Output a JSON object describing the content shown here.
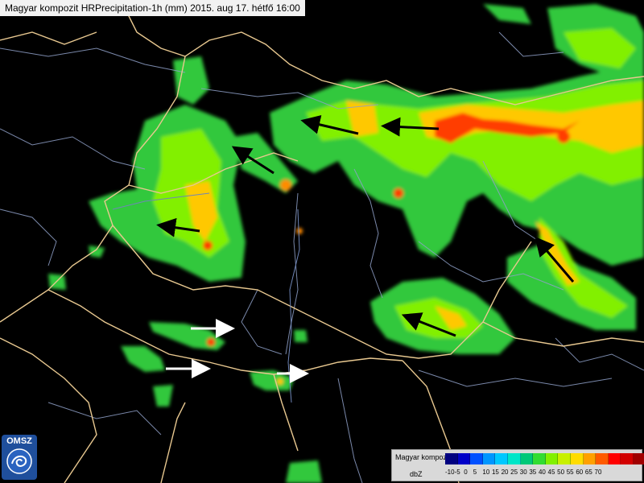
{
  "title": "Magyar kompozit HRPrecipitation-1h (mm) 2015. aug 17. hétfő 16:00",
  "logo": {
    "text": "OMSZ"
  },
  "legend": {
    "title": "Magyar kompozit",
    "unit": "dbZ",
    "levels": [
      {
        "value": "-10",
        "color": "#000080"
      },
      {
        "value": "-5",
        "color": "#0000c8"
      },
      {
        "value": "0",
        "color": "#0050ff"
      },
      {
        "value": "5",
        "color": "#0096ff"
      },
      {
        "value": "10",
        "color": "#00c8ff"
      },
      {
        "value": "15",
        "color": "#00e6c8"
      },
      {
        "value": "20",
        "color": "#00c878"
      },
      {
        "value": "25",
        "color": "#32dc32"
      },
      {
        "value": "30",
        "color": "#82f000"
      },
      {
        "value": "35",
        "color": "#c8f000"
      },
      {
        "value": "40",
        "color": "#ffdc00"
      },
      {
        "value": "45",
        "color": "#ffa000"
      },
      {
        "value": "50",
        "color": "#ff5a00"
      },
      {
        "value": "55",
        "color": "#ff0000"
      },
      {
        "value": "60",
        "color": "#d20000"
      },
      {
        "value": "65",
        "color": "#a00000"
      },
      {
        "value": "70",
        "color": "#780000"
      }
    ]
  },
  "colors": {
    "background": "#000000",
    "border_country": "#e8c890",
    "border_region": "#8fa0c8",
    "rain_light": "#32c83c",
    "rain_mid": "#82f000",
    "rain_heavy": "#ffc800",
    "rain_intense": "#ff3c00",
    "arrow_dark": "#000000",
    "arrow_light": "#ffffff"
  }
}
